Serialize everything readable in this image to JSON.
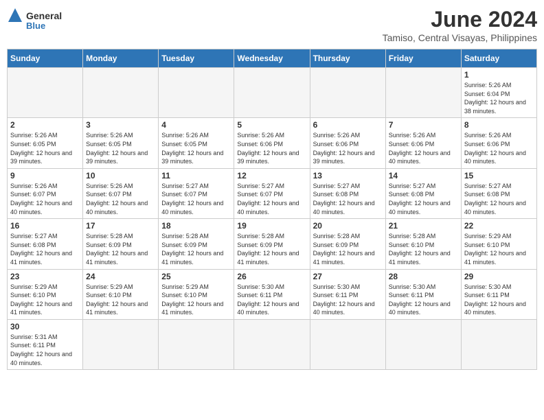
{
  "header": {
    "logo_general": "General",
    "logo_blue": "Blue",
    "title": "June 2024",
    "subtitle": "Tamiso, Central Visayas, Philippines"
  },
  "days_of_week": [
    "Sunday",
    "Monday",
    "Tuesday",
    "Wednesday",
    "Thursday",
    "Friday",
    "Saturday"
  ],
  "weeks": [
    [
      {
        "day": "",
        "info": "",
        "empty": true
      },
      {
        "day": "",
        "info": "",
        "empty": true
      },
      {
        "day": "",
        "info": "",
        "empty": true
      },
      {
        "day": "",
        "info": "",
        "empty": true
      },
      {
        "day": "",
        "info": "",
        "empty": true
      },
      {
        "day": "",
        "info": "",
        "empty": true
      },
      {
        "day": "1",
        "info": "Sunrise: 5:26 AM\nSunset: 6:04 PM\nDaylight: 12 hours and 38 minutes.",
        "empty": false
      }
    ],
    [
      {
        "day": "2",
        "info": "Sunrise: 5:26 AM\nSunset: 6:05 PM\nDaylight: 12 hours and 39 minutes.",
        "empty": false
      },
      {
        "day": "3",
        "info": "Sunrise: 5:26 AM\nSunset: 6:05 PM\nDaylight: 12 hours and 39 minutes.",
        "empty": false
      },
      {
        "day": "4",
        "info": "Sunrise: 5:26 AM\nSunset: 6:05 PM\nDaylight: 12 hours and 39 minutes.",
        "empty": false
      },
      {
        "day": "5",
        "info": "Sunrise: 5:26 AM\nSunset: 6:06 PM\nDaylight: 12 hours and 39 minutes.",
        "empty": false
      },
      {
        "day": "6",
        "info": "Sunrise: 5:26 AM\nSunset: 6:06 PM\nDaylight: 12 hours and 39 minutes.",
        "empty": false
      },
      {
        "day": "7",
        "info": "Sunrise: 5:26 AM\nSunset: 6:06 PM\nDaylight: 12 hours and 40 minutes.",
        "empty": false
      },
      {
        "day": "8",
        "info": "Sunrise: 5:26 AM\nSunset: 6:06 PM\nDaylight: 12 hours and 40 minutes.",
        "empty": false
      }
    ],
    [
      {
        "day": "9",
        "info": "Sunrise: 5:26 AM\nSunset: 6:07 PM\nDaylight: 12 hours and 40 minutes.",
        "empty": false
      },
      {
        "day": "10",
        "info": "Sunrise: 5:26 AM\nSunset: 6:07 PM\nDaylight: 12 hours and 40 minutes.",
        "empty": false
      },
      {
        "day": "11",
        "info": "Sunrise: 5:27 AM\nSunset: 6:07 PM\nDaylight: 12 hours and 40 minutes.",
        "empty": false
      },
      {
        "day": "12",
        "info": "Sunrise: 5:27 AM\nSunset: 6:07 PM\nDaylight: 12 hours and 40 minutes.",
        "empty": false
      },
      {
        "day": "13",
        "info": "Sunrise: 5:27 AM\nSunset: 6:08 PM\nDaylight: 12 hours and 40 minutes.",
        "empty": false
      },
      {
        "day": "14",
        "info": "Sunrise: 5:27 AM\nSunset: 6:08 PM\nDaylight: 12 hours and 40 minutes.",
        "empty": false
      },
      {
        "day": "15",
        "info": "Sunrise: 5:27 AM\nSunset: 6:08 PM\nDaylight: 12 hours and 40 minutes.",
        "empty": false
      }
    ],
    [
      {
        "day": "16",
        "info": "Sunrise: 5:27 AM\nSunset: 6:08 PM\nDaylight: 12 hours and 41 minutes.",
        "empty": false
      },
      {
        "day": "17",
        "info": "Sunrise: 5:28 AM\nSunset: 6:09 PM\nDaylight: 12 hours and 41 minutes.",
        "empty": false
      },
      {
        "day": "18",
        "info": "Sunrise: 5:28 AM\nSunset: 6:09 PM\nDaylight: 12 hours and 41 minutes.",
        "empty": false
      },
      {
        "day": "19",
        "info": "Sunrise: 5:28 AM\nSunset: 6:09 PM\nDaylight: 12 hours and 41 minutes.",
        "empty": false
      },
      {
        "day": "20",
        "info": "Sunrise: 5:28 AM\nSunset: 6:09 PM\nDaylight: 12 hours and 41 minutes.",
        "empty": false
      },
      {
        "day": "21",
        "info": "Sunrise: 5:28 AM\nSunset: 6:10 PM\nDaylight: 12 hours and 41 minutes.",
        "empty": false
      },
      {
        "day": "22",
        "info": "Sunrise: 5:29 AM\nSunset: 6:10 PM\nDaylight: 12 hours and 41 minutes.",
        "empty": false
      }
    ],
    [
      {
        "day": "23",
        "info": "Sunrise: 5:29 AM\nSunset: 6:10 PM\nDaylight: 12 hours and 41 minutes.",
        "empty": false
      },
      {
        "day": "24",
        "info": "Sunrise: 5:29 AM\nSunset: 6:10 PM\nDaylight: 12 hours and 41 minutes.",
        "empty": false
      },
      {
        "day": "25",
        "info": "Sunrise: 5:29 AM\nSunset: 6:10 PM\nDaylight: 12 hours and 41 minutes.",
        "empty": false
      },
      {
        "day": "26",
        "info": "Sunrise: 5:30 AM\nSunset: 6:11 PM\nDaylight: 12 hours and 40 minutes.",
        "empty": false
      },
      {
        "day": "27",
        "info": "Sunrise: 5:30 AM\nSunset: 6:11 PM\nDaylight: 12 hours and 40 minutes.",
        "empty": false
      },
      {
        "day": "28",
        "info": "Sunrise: 5:30 AM\nSunset: 6:11 PM\nDaylight: 12 hours and 40 minutes.",
        "empty": false
      },
      {
        "day": "29",
        "info": "Sunrise: 5:30 AM\nSunset: 6:11 PM\nDaylight: 12 hours and 40 minutes.",
        "empty": false
      }
    ],
    [
      {
        "day": "30",
        "info": "Sunrise: 5:31 AM\nSunset: 6:11 PM\nDaylight: 12 hours and 40 minutes.",
        "empty": false
      },
      {
        "day": "",
        "info": "",
        "empty": true
      },
      {
        "day": "",
        "info": "",
        "empty": true
      },
      {
        "day": "",
        "info": "",
        "empty": true
      },
      {
        "day": "",
        "info": "",
        "empty": true
      },
      {
        "day": "",
        "info": "",
        "empty": true
      },
      {
        "day": "",
        "info": "",
        "empty": true
      }
    ]
  ]
}
